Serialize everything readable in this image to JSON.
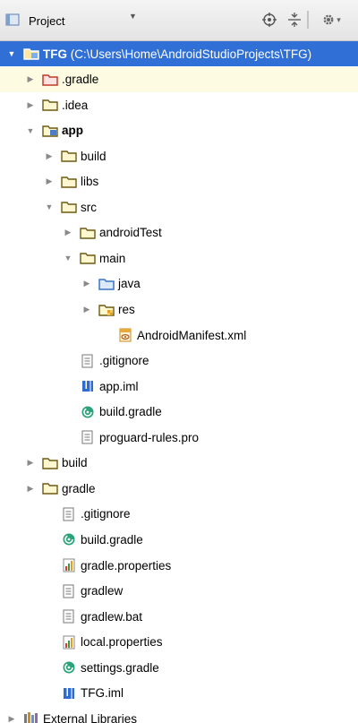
{
  "toolbar": {
    "view_label": "Project"
  },
  "tree": [
    {
      "label": "TFG",
      "suffix": "(C:\\Users\\Home\\AndroidStudioProjects\\TFG)",
      "depth": 0,
      "expand": "open",
      "icon": "project-module",
      "selected": true,
      "bold": true
    },
    {
      "label": ".gradle",
      "depth": 1,
      "expand": "closed",
      "icon": "folder-red",
      "highlight": true
    },
    {
      "label": ".idea",
      "depth": 1,
      "expand": "closed",
      "icon": "folder"
    },
    {
      "label": "app",
      "depth": 1,
      "expand": "open",
      "icon": "module",
      "bold": true
    },
    {
      "label": "build",
      "depth": 2,
      "expand": "closed",
      "icon": "folder"
    },
    {
      "label": "libs",
      "depth": 2,
      "expand": "closed",
      "icon": "folder"
    },
    {
      "label": "src",
      "depth": 2,
      "expand": "open",
      "icon": "folder"
    },
    {
      "label": "androidTest",
      "depth": 3,
      "expand": "closed",
      "icon": "folder"
    },
    {
      "label": "main",
      "depth": 3,
      "expand": "open",
      "icon": "folder"
    },
    {
      "label": "java",
      "depth": 4,
      "expand": "closed",
      "icon": "folder-blue"
    },
    {
      "label": "res",
      "depth": 4,
      "expand": "closed",
      "icon": "folder-res"
    },
    {
      "label": "AndroidManifest.xml",
      "depth": 5,
      "expand": "none",
      "icon": "xml-file"
    },
    {
      "label": ".gitignore",
      "depth": 3,
      "expand": "none",
      "icon": "text-file"
    },
    {
      "label": "app.iml",
      "depth": 3,
      "expand": "none",
      "icon": "iml-file"
    },
    {
      "label": "build.gradle",
      "depth": 3,
      "expand": "none",
      "icon": "gradle-file"
    },
    {
      "label": "proguard-rules.pro",
      "depth": 3,
      "expand": "none",
      "icon": "text-file"
    },
    {
      "label": "build",
      "depth": 1,
      "expand": "closed",
      "icon": "folder"
    },
    {
      "label": "gradle",
      "depth": 1,
      "expand": "closed",
      "icon": "folder"
    },
    {
      "label": ".gitignore",
      "depth": 2,
      "expand": "none",
      "icon": "text-file"
    },
    {
      "label": "build.gradle",
      "depth": 2,
      "expand": "none",
      "icon": "gradle-file"
    },
    {
      "label": "gradle.properties",
      "depth": 2,
      "expand": "none",
      "icon": "properties-file"
    },
    {
      "label": "gradlew",
      "depth": 2,
      "expand": "none",
      "icon": "text-file"
    },
    {
      "label": "gradlew.bat",
      "depth": 2,
      "expand": "none",
      "icon": "text-file"
    },
    {
      "label": "local.properties",
      "depth": 2,
      "expand": "none",
      "icon": "properties-file"
    },
    {
      "label": "settings.gradle",
      "depth": 2,
      "expand": "none",
      "icon": "gradle-file"
    },
    {
      "label": "TFG.iml",
      "depth": 2,
      "expand": "none",
      "icon": "iml-file"
    },
    {
      "label": "External Libraries",
      "depth": 0,
      "expand": "closed",
      "icon": "library"
    }
  ]
}
